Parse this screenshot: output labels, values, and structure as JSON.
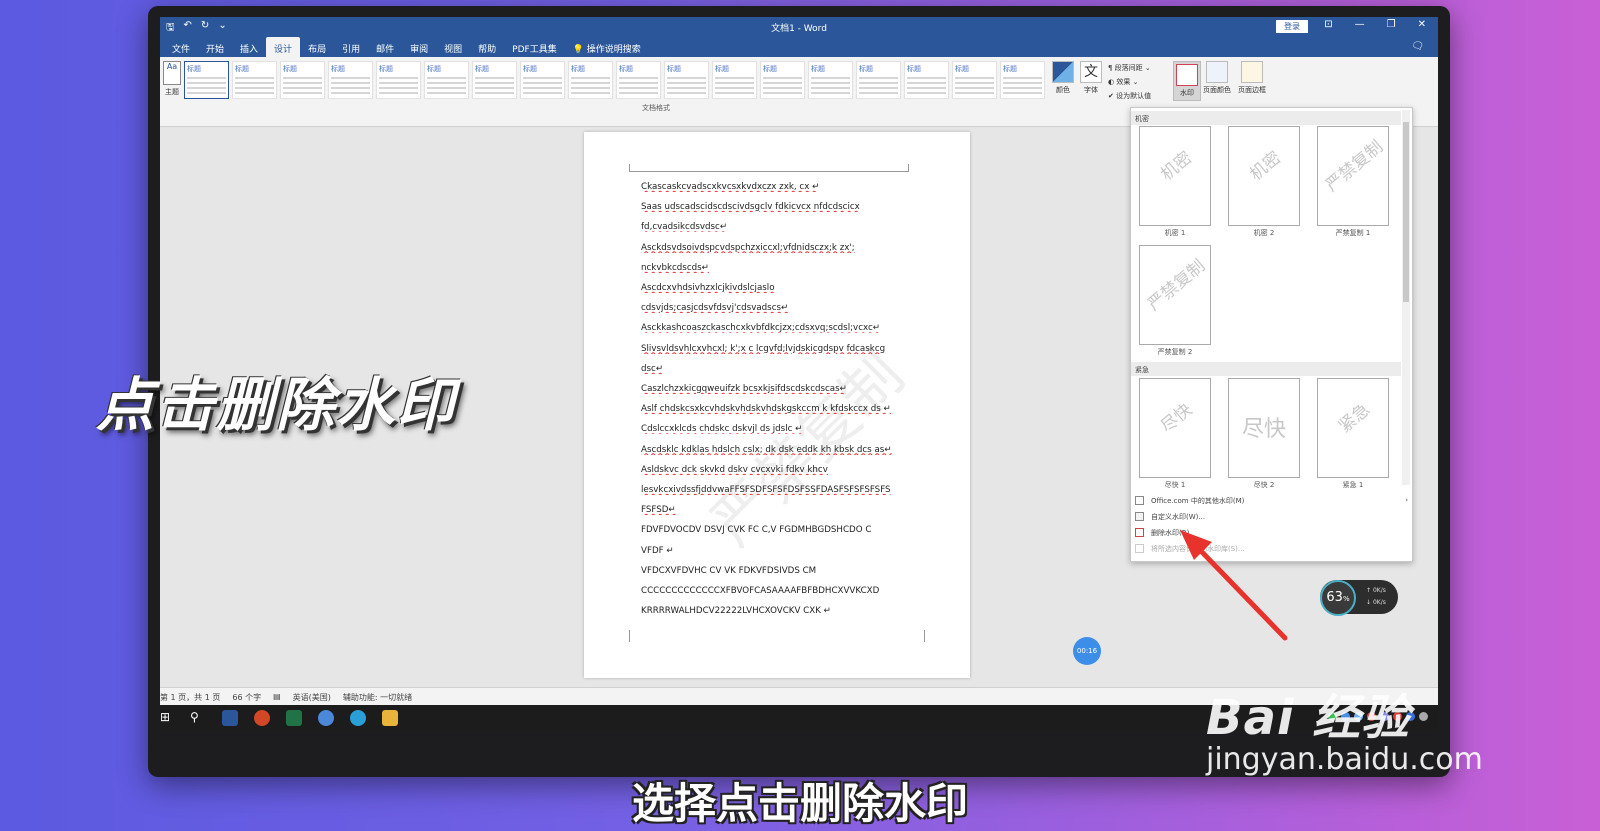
{
  "window": {
    "title": "文档1 - Word",
    "login_label": "登录",
    "controls": [
      "⊡",
      "—",
      "❐",
      "✕"
    ]
  },
  "menu": {
    "tabs": [
      "文件",
      "开始",
      "插入",
      "设计",
      "布局",
      "引用",
      "邮件",
      "审阅",
      "视图",
      "帮助",
      "PDF工具集"
    ],
    "active_tab": "设计",
    "tell_me": "操作说明搜索"
  },
  "ribbon": {
    "theme_label": "主题",
    "gallery_group": "文档格式",
    "gallery_items": [
      "标题",
      "标题",
      "标题",
      "标题",
      "标题",
      "标题",
      "标题",
      "标题",
      "标题",
      "标题",
      "标题",
      "标题",
      "标题",
      "标题",
      "标题",
      "标题",
      "标题",
      "标题"
    ],
    "colors_label": "颜色",
    "fonts_label": "字体",
    "paragraph_spacing": "段落间距",
    "effects": "效果",
    "set_default": "设为默认值",
    "watermark_label": "水印",
    "page_color_label": "页面颜色",
    "page_border_label": "页面边框"
  },
  "document": {
    "lines": [
      "Ckascaskcvadscxkvcsxkvdxczx zxk, cx ↵",
      "Saas    udscadscidscdscivdsgclv    fdkicvcx    nfdcdscicx",
      "fd,cvadsikcdsvdsc↵",
      "Asckdsvdsoivdspcvdspchzxiccxl;vfdnidsczx;k              zx';",
      "nckvbkcdscds↵",
      "Ascdcxvhdsivhzxlcjkivdslcjaslo",
      "cdsvjds;casjcdsvfdsvj'cdsvadscs↵",
      "Asckkashcoaszckaschcxkvbfdkcjzx;cdsxvq;scdsl;vcxc↵",
      "Slivsvldsvhlcxvhcxl;  k';x  c  lcgvfd;lvjdskicgdspv  fdcaskcg",
      "dsc↵",
      "Caszlchzxkicgqweuifzk bcsxkjsifdscdskcdscas↵",
      "Aslf chdskcsxkcvhdskvhdskvhdskgskccm k kfdskccx ds ↵",
      "Cdslccxklcds    chdskc dskvjl    ds jdslc ↵",
      "Ascdsklc kdklas hdslch cslx; dk dsk eddk kh kbsk dcs as↵",
      "Asldskvc    dck    skvkd    dskv       cvcxvki    fdkv    khcv",
      "lesvkcxivdssfjddvwaFFSFSDFSFSFDSFSSFDASFSFSFSFSFS",
      "FSFSD↵",
      "FDVFDVOCDV DSVJ CVK FC C,V FGDMHBGDSHCDO C",
      "VFDF ↵",
      "VFDCXVFDVHC     CV     VK     FDKVFDSIVDS            CM",
      "CCCCCCCCCCCCCXFBVOFCASAAAAFBFBDHCXVVKCXD",
      "KRRRRWALHDCV22222LVHCXOVCKV CXK         ↵"
    ],
    "watermark_text": "严禁复制"
  },
  "watermark_panel": {
    "section1": "机密",
    "section2": "紧急",
    "items": [
      {
        "thumb": "机密",
        "caption": "机密 1"
      },
      {
        "thumb": "机密",
        "caption": "机密 2"
      },
      {
        "thumb": "严禁复制",
        "caption": "严禁复制 1"
      },
      {
        "thumb": "严禁复制",
        "caption": "严禁复制 2"
      },
      {
        "thumb": "尽快",
        "caption": "尽快 1"
      },
      {
        "thumb": "尽快",
        "caption": "尽快 2"
      },
      {
        "thumb": "紧急",
        "caption": "紧急 1"
      }
    ],
    "menu": [
      "Office.com 中的其他水印(M)",
      "自定义水印(W)...",
      "删除水印(R)",
      "将所选内容保存到水印库(S)..."
    ]
  },
  "status": {
    "page": "第 1 页，共 1 页",
    "words": "66 个字",
    "lang": "英语(美国)",
    "accessibility": "辅助功能: 一切就绪"
  },
  "widgets": {
    "timer": "00:16",
    "cpu": "63",
    "cpu_unit": "%",
    "up_rate": "0K/s",
    "down_rate": "0K/s"
  },
  "overlay": {
    "caption": "点击删除水印",
    "subtitle": "选择点击删除水印"
  },
  "brand": {
    "logo": "Bai 经验",
    "url": "jingyan.baidu.com"
  },
  "colors": {
    "word_blue": "#2b579a",
    "arrow_red": "#e8322c"
  }
}
